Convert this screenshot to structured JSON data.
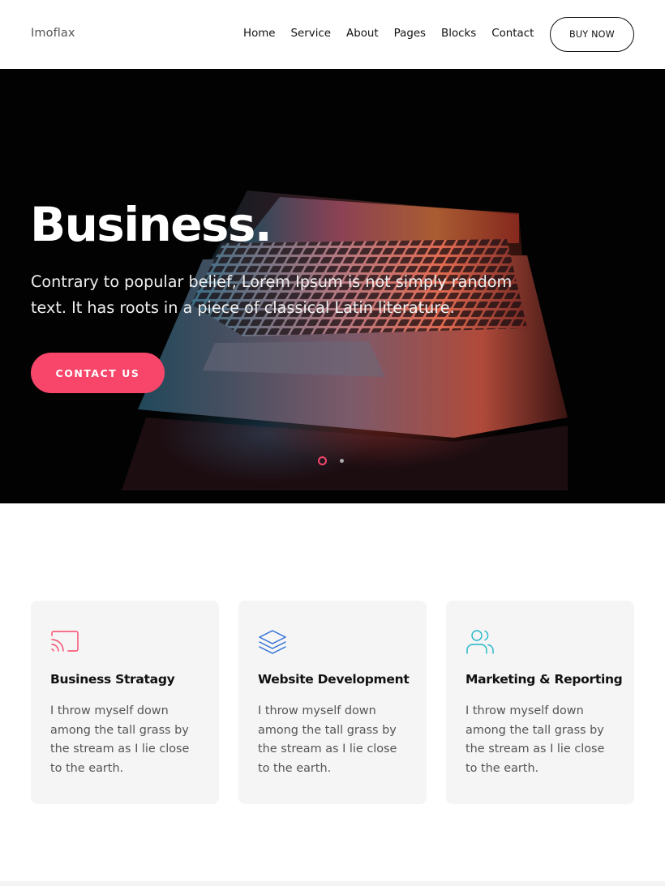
{
  "header": {
    "logo": "Imoflax",
    "nav": [
      "Home",
      "Service",
      "About",
      "Pages",
      "Blocks",
      "Contact"
    ],
    "buy_label": "BUY NOW"
  },
  "hero": {
    "title": "Business.",
    "text": "Contrary to popular belief, Lorem Ipsum is not simply random text. It has roots in a piece of classical Latin literature.",
    "cta_label": "CONTACT US",
    "slides": 2,
    "active_slide": 1
  },
  "features": [
    {
      "icon": "cast-icon",
      "title": "Business Stratagy",
      "text": "I throw myself down among the tall grass by the stream as I lie close to the earth.",
      "color": "#f7466a"
    },
    {
      "icon": "layers-icon",
      "title": "Website Development",
      "text": "I throw myself down among the tall grass by the stream as I lie close to the earth.",
      "color": "#2f6fd6"
    },
    {
      "icon": "users-icon",
      "title": "Marketing & Reporting",
      "text": "I throw myself down among the tall grass by the stream as I lie close to the earth.",
      "color": "#21b7c7"
    }
  ],
  "colors": {
    "accent": "#f7466a",
    "card_background": "#f5f5f5"
  }
}
